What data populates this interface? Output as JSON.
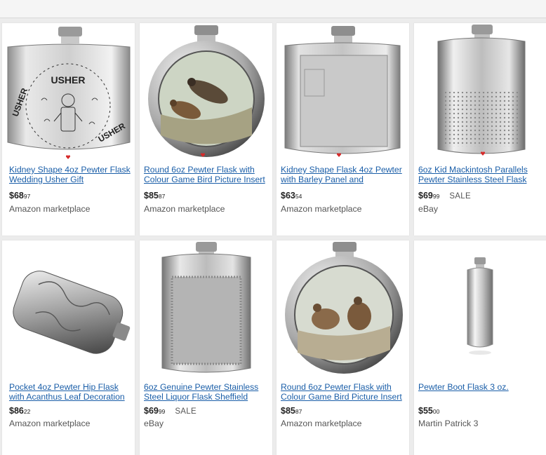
{
  "products": [
    {
      "title": "Kidney Shape 4oz Pewter Flask Wedding Usher Gift",
      "price_main": "$68",
      "price_cents": "97",
      "badge": "",
      "seller": "Amazon marketplace",
      "image": "usher-engraved-pewter-flask",
      "engraving": {
        "top": "USHER",
        "ring": "USHER",
        "bottom": "USHER"
      }
    },
    {
      "title": "Round 6oz Pewter Flask with Colour Game Bird Picture Insert",
      "price_main": "$85",
      "price_cents": "87",
      "badge": "",
      "seller": "Amazon marketplace",
      "image": "round-flask-pheasant-picture"
    },
    {
      "title": "Kidney Shape Flask 4oz Pewter with Barley Panel and",
      "price_main": "$63",
      "price_cents": "54",
      "badge": "",
      "seller": "Amazon marketplace",
      "image": "barley-panel-pewter-flask"
    },
    {
      "title": "6oz Kid Mackintosh Parallels Pewter Stainless Steel Flask",
      "price_main": "$69",
      "price_cents": "99",
      "badge": "SALE",
      "seller": "eBay",
      "image": "mackintosh-dotted-flask"
    },
    {
      "title": "Pocket 4oz Pewter Hip Flask with Acanthus Leaf Decoration",
      "price_main": "$86",
      "price_cents": "22",
      "badge": "",
      "seller": "Amazon marketplace",
      "image": "acanthus-leaf-hip-flask"
    },
    {
      "title": "6oz Genuine Pewter Stainless Steel Liquor Flask Sheffield",
      "price_main": "$69",
      "price_cents": "99",
      "badge": "SALE",
      "seller": "eBay",
      "image": "sheffield-pewter-flask"
    },
    {
      "title": "Round 6oz Pewter Flask with Colour Game Bird Picture Insert",
      "price_main": "$85",
      "price_cents": "87",
      "badge": "",
      "seller": "Amazon marketplace",
      "image": "round-flask-partridge-picture"
    },
    {
      "title": "Pewter Boot Flask 3 oz.",
      "price_main": "$55",
      "price_cents": "00",
      "badge": "",
      "seller": "Martin Patrick 3",
      "image": "boot-flask"
    }
  ],
  "colors": {
    "link": "#1a5ea8",
    "background": "#ececec",
    "card": "#ffffff"
  }
}
